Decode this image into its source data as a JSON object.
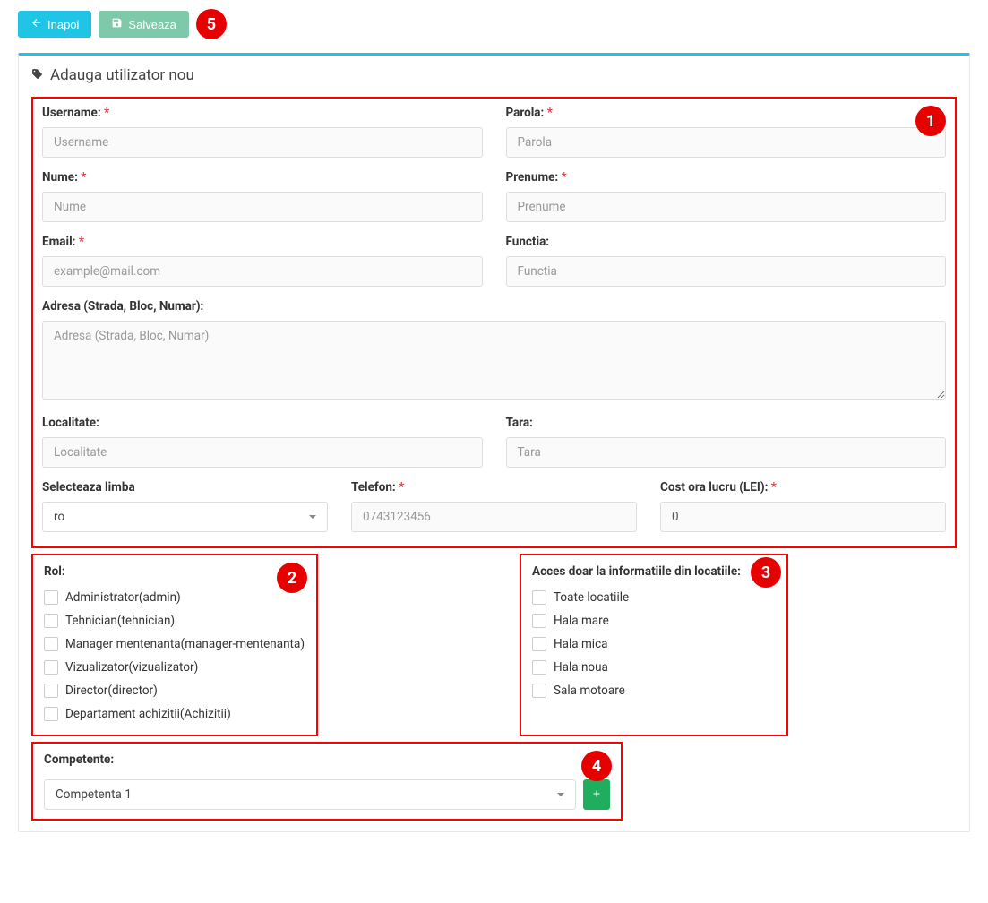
{
  "toolbar": {
    "back_label": "Inapoi",
    "save_label": "Salveaza"
  },
  "annotations": {
    "n1": "1",
    "n2": "2",
    "n3": "3",
    "n4": "4",
    "n5": "5"
  },
  "panel": {
    "title": "Adauga utilizator nou"
  },
  "fields": {
    "username": {
      "label": "Username:",
      "placeholder": "Username"
    },
    "parola": {
      "label": "Parola:",
      "placeholder": "Parola"
    },
    "nume": {
      "label": "Nume:",
      "placeholder": "Nume"
    },
    "prenume": {
      "label": "Prenume:",
      "placeholder": "Prenume"
    },
    "email": {
      "label": "Email:",
      "placeholder": "example@mail.com"
    },
    "functia": {
      "label": "Functia:",
      "placeholder": "Functia"
    },
    "adresa": {
      "label": "Adresa (Strada, Bloc, Numar):",
      "placeholder": "Adresa (Strada, Bloc, Numar)"
    },
    "localitate": {
      "label": "Localitate:",
      "placeholder": "Localitate"
    },
    "tara": {
      "label": "Tara:",
      "placeholder": "Tara"
    },
    "limba": {
      "label": "Selecteaza limba",
      "value": "ro"
    },
    "telefon": {
      "label": "Telefon:",
      "placeholder": "0743123456"
    },
    "cost": {
      "label": "Cost ora lucru (LEI):",
      "value": "0"
    }
  },
  "rol": {
    "label": "Rol:",
    "items": {
      "i0": "Administrator(admin)",
      "i1": "Tehnician(tehnician)",
      "i2": "Manager mentenanta(manager-mentenanta)",
      "i3": "Vizualizator(vizualizator)",
      "i4": "Director(director)",
      "i5": "Departament achizitii(Achizitii)"
    }
  },
  "acces": {
    "label": "Acces doar la informatiile din locatiile:",
    "items": {
      "i0": "Toate locatiile",
      "i1": "Hala mare",
      "i2": "Hala mica",
      "i3": "Hala noua",
      "i4": "Sala motoare"
    }
  },
  "competente": {
    "label": "Competente:",
    "value": "Competenta 1"
  },
  "required": "*"
}
